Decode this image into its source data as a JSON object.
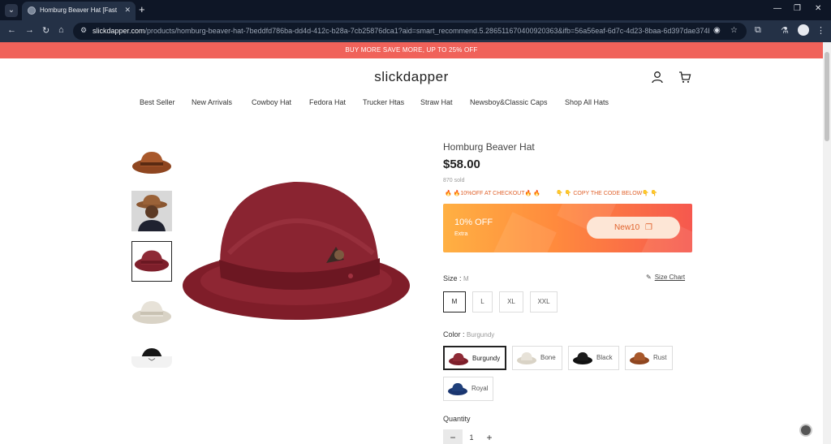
{
  "browser": {
    "tab_title": "Homburg Beaver Hat [Fast ship",
    "new_tab_icon": "plus-icon",
    "url_domain": "slickdapper.com",
    "url_path": "/products/homburg-beaver-hat-7beddfd786ba-dd4d-412c-b28a-7cb25876dca1?aid=smart_recommend.5.286511670400920363&ifb=56a56eaf-6d7c-4d23-8baa-6d397dae374b&cfb=56a"
  },
  "promo_bar": {
    "text": "BUY MORE SAVE MORE, UP TO 25% OFF",
    "color": "#f0625a"
  },
  "header": {
    "logo": "slickdapper",
    "account_icon": "user-icon",
    "cart_icon": "cart-icon"
  },
  "nav": [
    {
      "label": "Best Seller"
    },
    {
      "label": "New Arrivals"
    },
    {
      "label": "Cowboy Hat"
    },
    {
      "label": "Fedora Hat"
    },
    {
      "label": "Trucker Htas"
    },
    {
      "label": "Straw Hat"
    },
    {
      "label": "Newsboy&Classic Caps"
    },
    {
      "label": "Shop All Hats"
    }
  ],
  "gallery": {
    "thumbnails": [
      "rust-hat",
      "model-with-hat",
      "burgundy-hat",
      "bone-hat",
      "black-hat"
    ],
    "active_index": 2
  },
  "product": {
    "title": "Homburg Beaver Hat",
    "price": "$58.00",
    "sold": "870 sold",
    "promo_left": "🔥 🔥10%OFF AT CHECKOUT🔥 🔥",
    "promo_right": "👇 👇 COPY THE CODE BELOW👇 👇",
    "coupon": {
      "off": "10% OFF",
      "extra": "Extra",
      "code": "New10"
    },
    "size": {
      "label": "Size",
      "selected": "M",
      "chart_label": "Size Chart",
      "options": [
        "M",
        "L",
        "XL",
        "XXL"
      ]
    },
    "color": {
      "label": "Color",
      "selected": "Burgundy",
      "options": [
        {
          "name": "Burgundy",
          "hex": "#8a2430"
        },
        {
          "name": "Bone",
          "hex": "#e6e1d6"
        },
        {
          "name": "Black",
          "hex": "#151515"
        },
        {
          "name": "Rust",
          "hex": "#9a4a26"
        },
        {
          "name": "Royal",
          "hex": "#1f3f7a"
        }
      ]
    },
    "quantity": {
      "label": "Quantity",
      "value": "1",
      "minus": "−",
      "plus": "+"
    }
  }
}
